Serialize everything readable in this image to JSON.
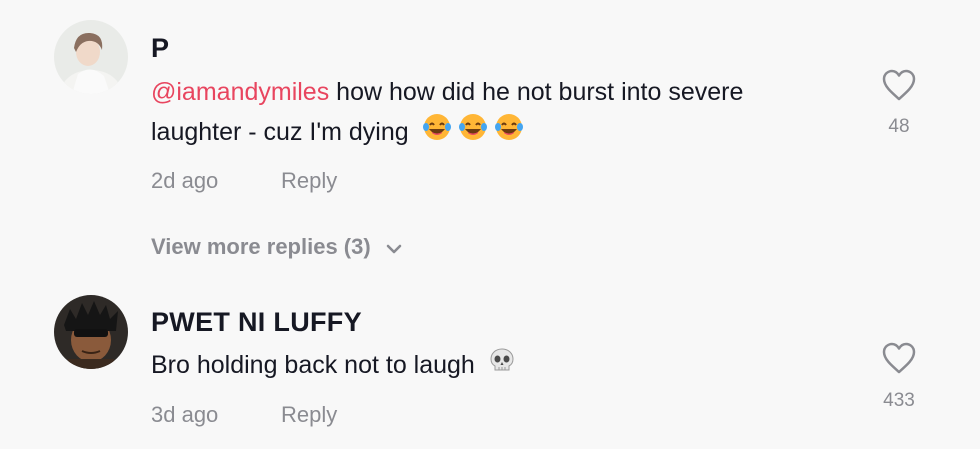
{
  "comments": [
    {
      "username": "P",
      "mention": "@iamandymiles",
      "text_line1": " how how did he not burst into severe",
      "text_line2": "laughter - cuz I'm dying",
      "time": "2d ago",
      "reply_label": "Reply",
      "likes": "48",
      "emojis": [
        "laughing-tears-emoji",
        "laughing-tears-emoji",
        "laughing-tears-emoji"
      ]
    },
    {
      "username": "PWET NI LUFFY",
      "text": "Bro holding back not to laugh",
      "time": "3d ago",
      "reply_label": "Reply",
      "likes": "433",
      "emojis": [
        "skull-emoji"
      ]
    }
  ],
  "view_more": "View more replies (3)",
  "icons": {
    "like": "heart-outline-icon",
    "expand": "chevron-down-icon"
  },
  "colors": {
    "mention": "#e8455f",
    "muted": "#8a8b91",
    "text": "#161823",
    "background": "#f8f8f8"
  }
}
